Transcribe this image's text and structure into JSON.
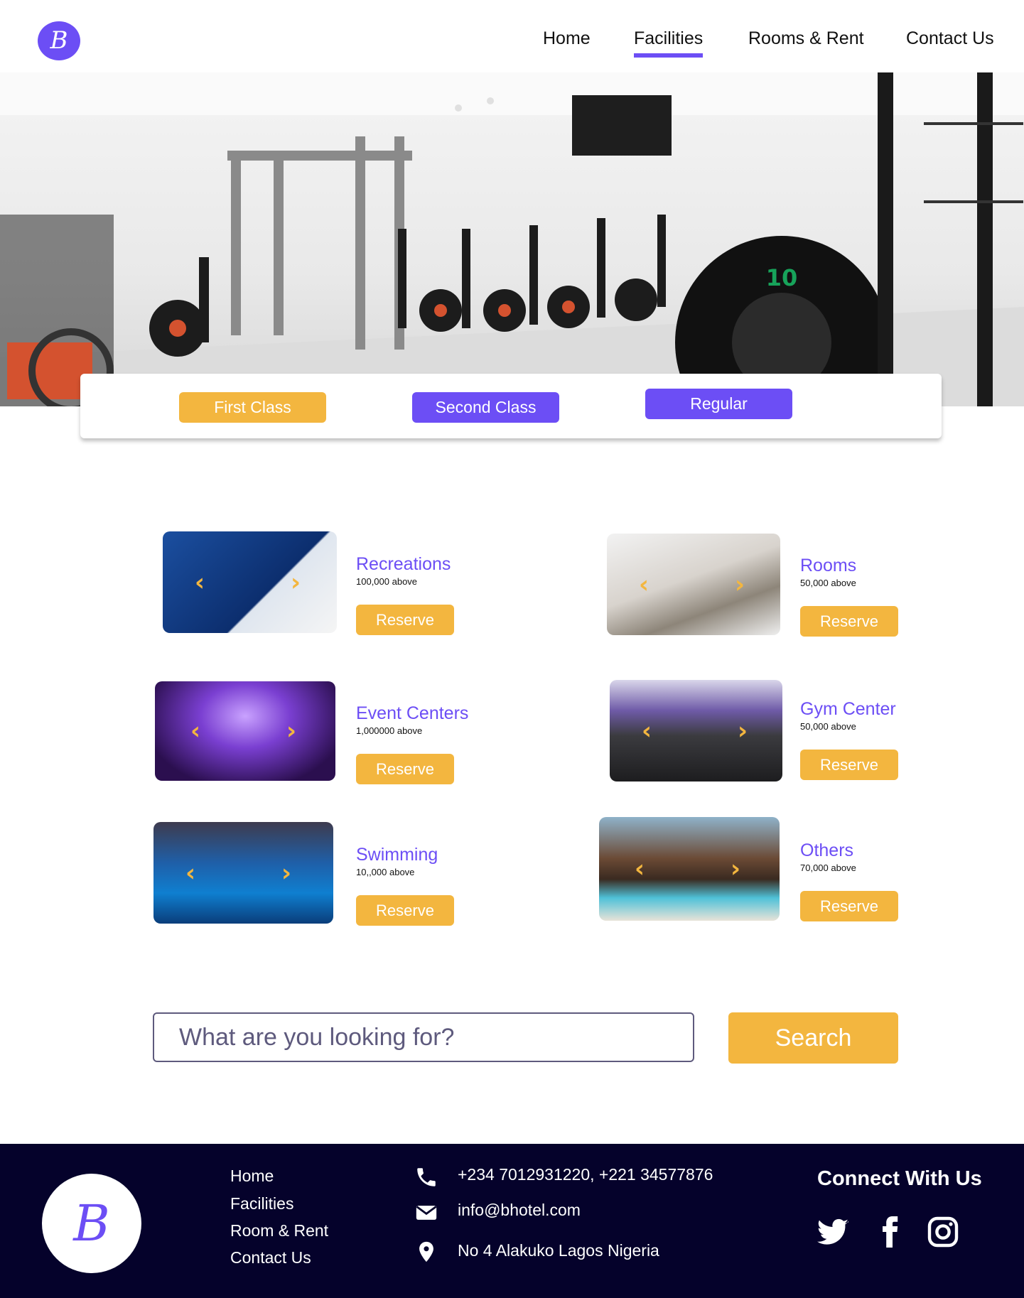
{
  "brand": {
    "logo_letter": "B"
  },
  "nav": {
    "items": [
      "Home",
      "Facilities",
      "Rooms & Rent",
      "Contact Us"
    ],
    "active": "Facilities"
  },
  "class_tabs": [
    "First Class",
    "Second  Class",
    "Regular"
  ],
  "facilities": [
    {
      "title": "Recreations",
      "price": "100,000 above",
      "button": "Reserve"
    },
    {
      "title": "Rooms",
      "price": "50,000 above",
      "button": "Reserve"
    },
    {
      "title": "Event Centers",
      "price": "1,000000 above",
      "button": "Reserve"
    },
    {
      "title": "Gym Center",
      "price": "50,000 above",
      "button": "Reserve"
    },
    {
      "title": "Swimming",
      "price": "10,,000 above",
      "button": "Reserve"
    },
    {
      "title": "Others",
      "price": "70,000 above",
      "button": "Reserve"
    }
  ],
  "search": {
    "placeholder": "What are you looking for?",
    "button": "Search"
  },
  "footer": {
    "links": [
      "Home",
      "Facilities",
      "Room & Rent",
      "Contact Us"
    ],
    "phone": "+234 7012931220, +221 34577876",
    "email": "info@bhotel.com",
    "address": "No 4 Alakuko Lagos Nigeria",
    "connect_title": "Connect With Us",
    "social_icons": [
      "twitter-icon",
      "facebook-icon",
      "instagram-icon"
    ]
  },
  "colors": {
    "accent": "#6c4ef5",
    "gold": "#f3b63f",
    "footer_bg": "#05022b"
  }
}
